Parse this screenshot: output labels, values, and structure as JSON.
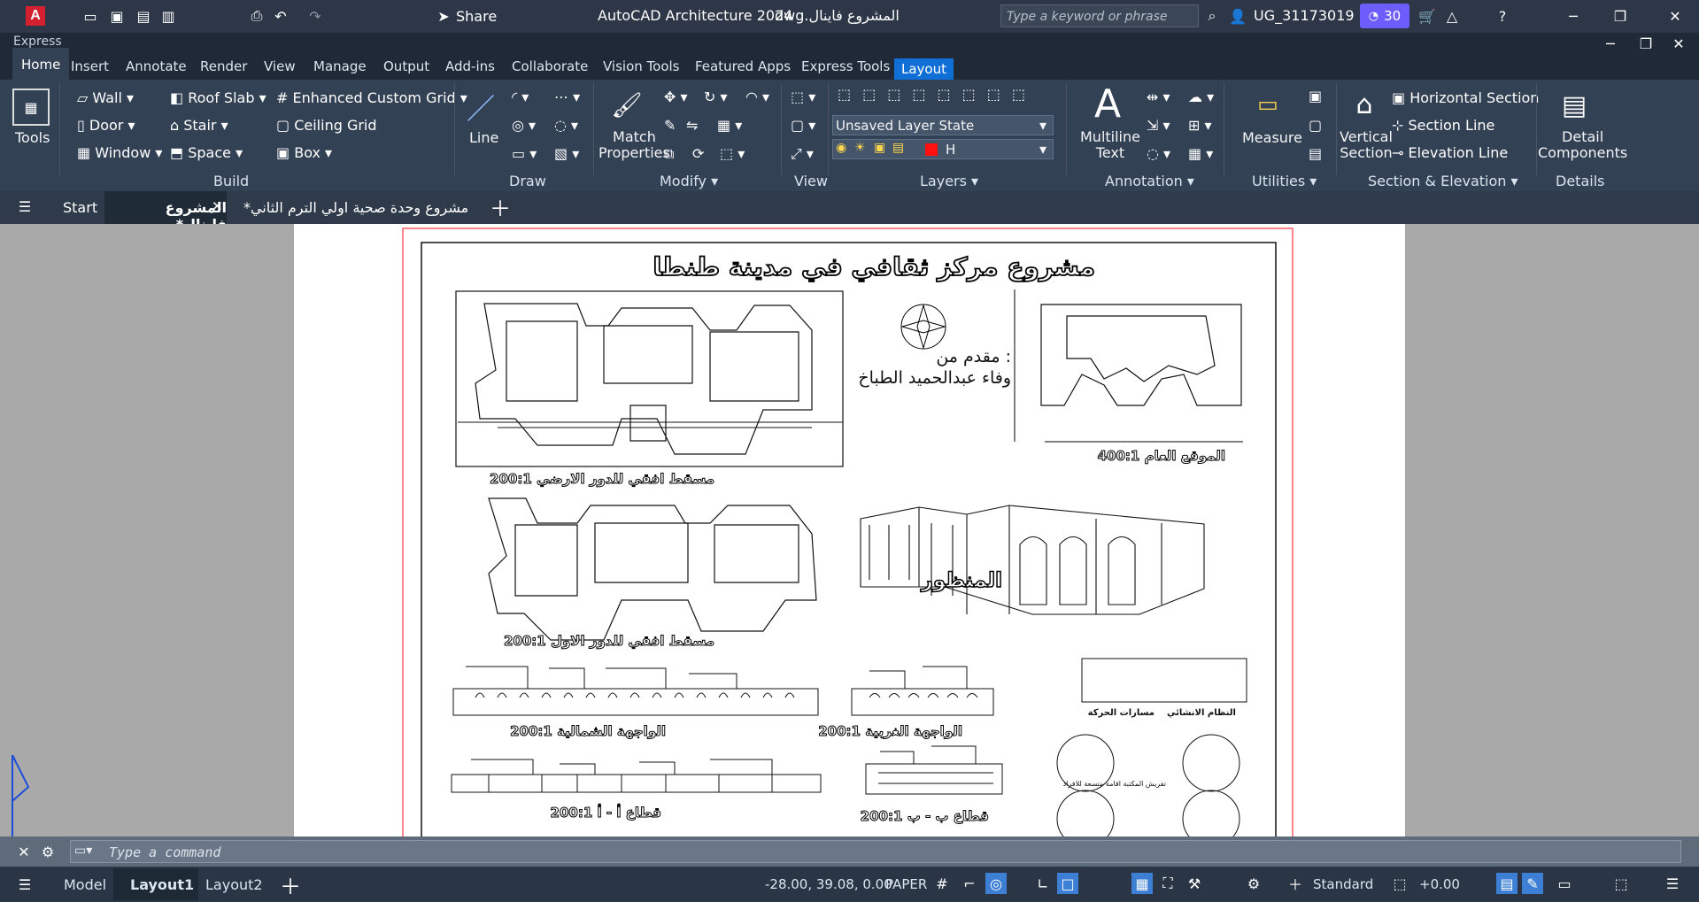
{
  "titlebar": {
    "app_title": "AutoCAD Architecture 2024",
    "file_name": "المشروع فاينال.dwg",
    "share_label": "Share",
    "search_placeholder": "Type a keyword or phrase",
    "user_id": "UG_31173019",
    "badge_number": "30",
    "express_label": "Express"
  },
  "ribbon_tabs": [
    "Home",
    "Insert",
    "Annotate",
    "Render",
    "View",
    "Manage",
    "Output",
    "Add-ins",
    "Collaborate",
    "Vision Tools",
    "Featured Apps",
    "Express Tools",
    "Layout"
  ],
  "ribbon": {
    "tools_label": "Tools",
    "build": {
      "label": "Build",
      "wall": "Wall",
      "door": "Door",
      "window": "Window",
      "roof_slab": "Roof Slab",
      "stair": "Stair",
      "space": "Space",
      "enhanced_grid": "Enhanced Custom Grid",
      "ceiling_grid": "Ceiling Grid",
      "box": "Box"
    },
    "draw": {
      "label": "Draw",
      "line": "Line"
    },
    "modify": {
      "label": "Modify",
      "match_properties": "Match\nProperties"
    },
    "view": {
      "label": "View"
    },
    "layers": {
      "label": "Layers",
      "layer_state": "Unsaved Layer State",
      "current_layer": "H"
    },
    "annotation": {
      "label": "Annotation",
      "multiline_text": "Multiline\nText"
    },
    "utilities": {
      "label": "Utilities",
      "measure": "Measure"
    },
    "section": {
      "label": "Section & Elevation",
      "vertical_section": "Vertical\nSection",
      "horizontal_section": "Horizontal Section",
      "section_line": "Section Line",
      "elevation_line": "Elevation Line"
    },
    "details": {
      "label": "Details",
      "detail_components": "Detail\nComponents"
    }
  },
  "file_tabs": {
    "start": "Start",
    "active_file": "المشروع فاينال*",
    "second_file": "مشروع وحدة صحية اولي الترم الثاني*"
  },
  "drawing": {
    "title": "مشروع مركز ثقافي في مدينة طنطا",
    "presented_by": "مقدم من :",
    "student_name": "وفاء عبدالحميد الطباخ",
    "plan_ground": "مسقط افقي للدور الارضي 200:1",
    "site_plan": "الموقع العام 400:1",
    "plan_first": "مسقط افقي للدور الاول 200:1",
    "perspective": "المنظور",
    "north_elevation": "الواجهة الشمالية 200:1",
    "west_elevation": "الواجهة الغربية 200:1",
    "section_aa": "قطاع أ - أ 200:1",
    "section_bb": "قطاع ب - ب 200:1",
    "structural_system": "النظام الانشائي",
    "movement_paths": "مسارات الحركة",
    "furniture_note": "تفريش المكتبة\nاقامة متسعة للافراد"
  },
  "command": {
    "placeholder": "Type a command"
  },
  "statusbar": {
    "model": "Model",
    "layout1": "Layout1",
    "layout2": "Layout2",
    "coordinates": "-28.00, 39.08, 0.00",
    "paper": "PAPER",
    "scale": "Standard",
    "angle": "+0.00"
  }
}
